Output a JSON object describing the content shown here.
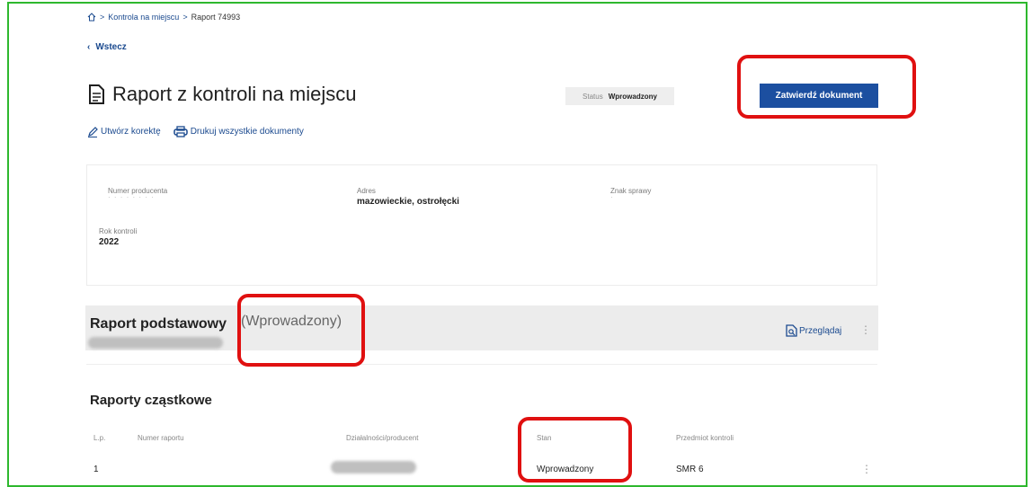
{
  "breadcrumb": {
    "items": [
      "Kontrola na miejscu",
      "Raport 74993"
    ],
    "separator": ">"
  },
  "back": {
    "label": "Wstecz"
  },
  "page": {
    "title": "Raport z kontroli na miejscu",
    "status_label": "Status",
    "status_value": "Wprowadzony",
    "approve_button": "Zatwierdź dokument"
  },
  "actions": {
    "correction": "Utwórz korektę",
    "print_all": "Drukuj wszystkie dokumenty"
  },
  "info": {
    "producer_number_label": "Numer producenta",
    "address_label": "Adres",
    "address_value": "mazowieckie, ostrołęcki",
    "case_sign_label": "Znak sprawy",
    "year_label": "Rok kontroli",
    "year_value": "2022"
  },
  "basic_report": {
    "title": "Raport podstawowy",
    "state": "(Wprowadzony)",
    "browse": "Przeglądaj"
  },
  "partial_reports": {
    "title": "Raporty cząstkowe",
    "columns": [
      "L.p.",
      "Numer raportu",
      "Działalności/producent",
      "Stan",
      "Przedmiot kontroli"
    ],
    "rows": [
      {
        "lp": "1",
        "state": "Wprowadzony",
        "subject": "SMR 6"
      }
    ]
  },
  "colors": {
    "primary": "#1c4fa0",
    "link": "#1b4a8f",
    "highlight": "#e01010",
    "frame": "#2eb82e"
  },
  "icons": [
    "home-icon",
    "chevron-left-icon",
    "document-icon",
    "pencil-icon",
    "printer-icon",
    "preview-icon",
    "kebab-icon"
  ]
}
